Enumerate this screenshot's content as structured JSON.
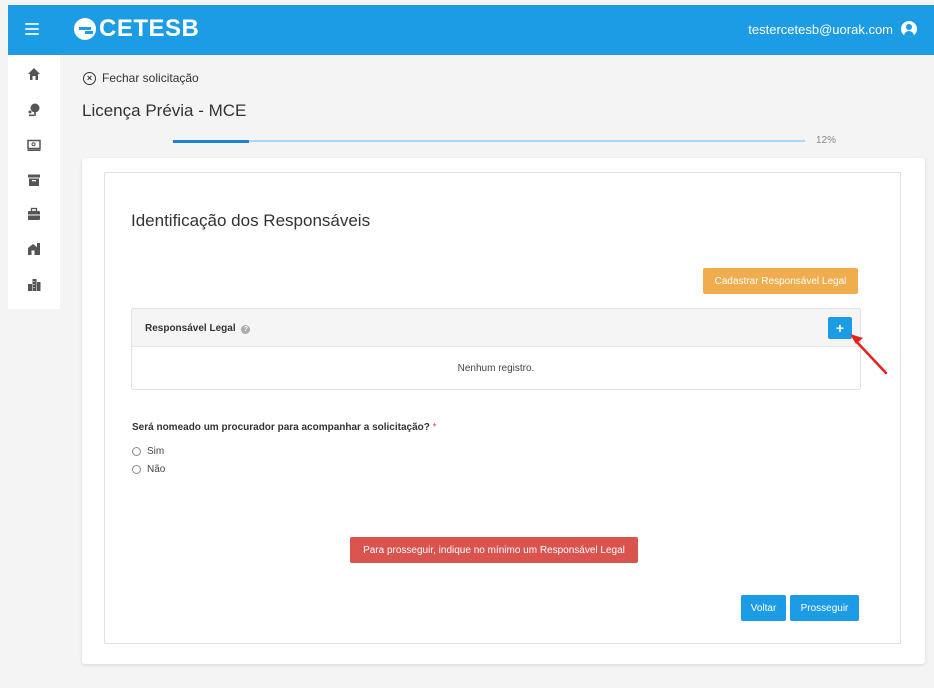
{
  "header": {
    "logo_text": "CETESB",
    "user_email": "testercetesb@uorak.com",
    "brand_color": "#1c9ce4"
  },
  "sidebar": {
    "icons": [
      "home-icon",
      "tree-icon",
      "monitor-icon",
      "archive-icon",
      "briefcase-icon",
      "building-icon",
      "city-icon"
    ]
  },
  "page": {
    "close_label": "Fechar solicitação",
    "title": "Licença Prévia - MCE",
    "progress_value": 12,
    "progress_label": "12%"
  },
  "form": {
    "section_title": "Identificação dos Responsáveis",
    "register_button": "Cadastrar Responsável Legal",
    "panel_title": "Responsável Legal",
    "add_button": "+",
    "empty_text": "Nenhum registro.",
    "question": "Será nomeado um procurador para acompanhar a solicitação?",
    "required_mark": "*",
    "options": [
      "Sim",
      "Não"
    ],
    "warning_button": "Para prosseguir, indique no mínimo um Responsável Legal",
    "back_button": "Voltar",
    "next_button": "Prosseguir"
  },
  "colors": {
    "accent": "#1c9ce4",
    "warning": "#f0ad4e",
    "danger": "#d9534f",
    "annotation_arrow": "#e8201c"
  }
}
